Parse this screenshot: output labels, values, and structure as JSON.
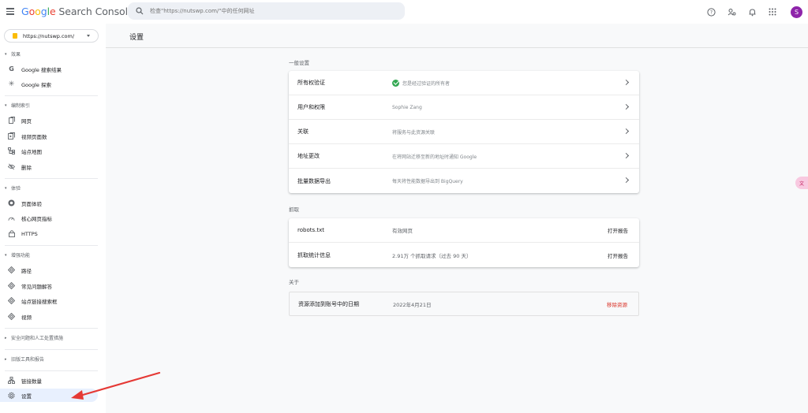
{
  "app": {
    "logo_google": "Google",
    "logo_product": "Search Console"
  },
  "search": {
    "placeholder": "检查\"https://nutswp.com/\"中的任何网址"
  },
  "user": {
    "initial": "S"
  },
  "property": {
    "url": "https://nutswp.com/"
  },
  "sidebar": {
    "sections": [
      {
        "title": "效果",
        "items": [
          "Google 搜索结果",
          "Google 探索"
        ]
      },
      {
        "title": "编制索引",
        "items": [
          "网页",
          "视频页面数",
          "站点地图",
          "删除"
        ]
      },
      {
        "title": "体验",
        "items": [
          "页面体验",
          "核心网页指标",
          "HTTPS"
        ]
      },
      {
        "title": "增强功能",
        "items": [
          "路径",
          "常见问题解答",
          "站点链接搜索框",
          "视频"
        ]
      },
      {
        "title": "安全问题和人工处置措施"
      },
      {
        "title": "旧版工具和报告"
      }
    ],
    "bottom_items": [
      "链接数量",
      "设置"
    ]
  },
  "page": {
    "title": "设置"
  },
  "general": {
    "heading": "一般设置",
    "rows": [
      {
        "label": "所有权验证",
        "value": "您是经过验证的所有者"
      },
      {
        "label": "用户和权限",
        "value": "Sophie Zang"
      },
      {
        "label": "关联",
        "value": "将服务与此资源关联"
      },
      {
        "label": "地址更改",
        "value": "在将网站迁移至新的地址时通知 Google"
      },
      {
        "label": "批量数据导出",
        "value": "每天将性能数据导出到 BigQuery"
      }
    ]
  },
  "crawl": {
    "heading": "抓取",
    "rows": [
      {
        "label": "robots.txt",
        "value": "有效网页",
        "action": "打开报告"
      },
      {
        "label": "抓取统计信息",
        "value": "2.91万 个抓取请求（过去 90 天）",
        "action": "打开报告"
      }
    ]
  },
  "about": {
    "heading": "关于",
    "row": {
      "label": "资源添加到账号中的日期",
      "value": "2022年4月21日",
      "action": "移除资源"
    }
  },
  "colors": {
    "accent": "#1a73e8",
    "verified": "#34a853",
    "danger": "#d93025",
    "avatar": "#8e24aa"
  }
}
